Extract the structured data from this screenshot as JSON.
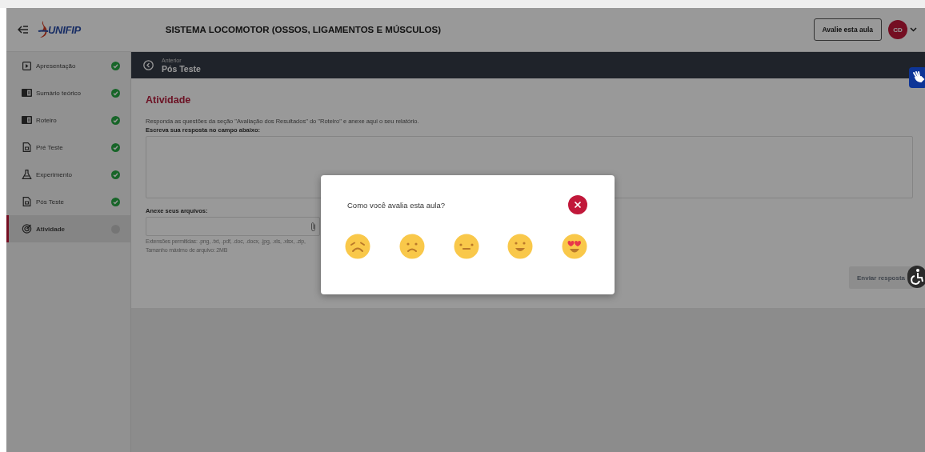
{
  "header": {
    "logo": "UNIFIP",
    "title": "SISTEMA LOCOMOTOR (OSSOS, LIGAMENTOS E MÚSCULOS)",
    "rate_button": "Avalie esta aula",
    "avatar": "CD"
  },
  "sidebar": {
    "items": [
      {
        "kind": "video",
        "label": "Apresentação",
        "completed": true,
        "selected": false
      },
      {
        "kind": "book",
        "label": "Sumário teórico",
        "completed": true,
        "selected": false
      },
      {
        "kind": "book",
        "label": "Roteiro",
        "completed": true,
        "selected": false
      },
      {
        "kind": "test",
        "label": "Pré Teste",
        "completed": true,
        "selected": false
      },
      {
        "kind": "experiment",
        "label": "Experimento",
        "completed": true,
        "selected": false
      },
      {
        "kind": "test",
        "label": "Pós Teste",
        "completed": true,
        "selected": false
      },
      {
        "kind": "activity",
        "label": "Atividade",
        "completed": false,
        "selected": true
      }
    ]
  },
  "nav_bar": {
    "caption": "Anterior",
    "title": "Pós Teste"
  },
  "activity": {
    "heading": "Atividade",
    "instructions": "Responda as questões da seção \"Avaliação dos Resultados\" do \"Roteiro\" e anexe aqui o seu relatório.",
    "answer_label": "Escreva sua resposta no campo abaixo:",
    "attach_label": "Anexe seus arquivos:",
    "extensions": "Extensões permitidas: .png, .txt, .pdf, .doc, .docx, .jpg, .xls, .xlsx, .zip,",
    "max_size": "Tamanho máximo de arquivo: 2MB",
    "submit_button": "Enviar resposta",
    "submit_disabled": true
  },
  "modal": {
    "title": "Como você avalia esta aula?",
    "ratings": [
      {
        "kind": "weary"
      },
      {
        "kind": "sad"
      },
      {
        "kind": "neutral"
      },
      {
        "kind": "happy"
      },
      {
        "kind": "love"
      }
    ]
  }
}
